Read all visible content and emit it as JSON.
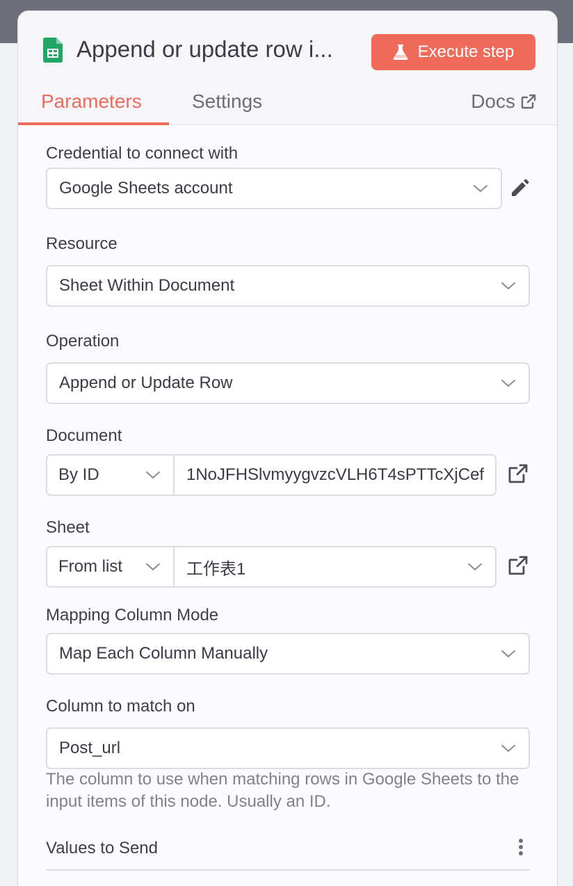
{
  "header": {
    "title": "Append or update row i...",
    "icon": "google-sheets-icon",
    "execute_label": "Execute step",
    "accent_color": "#ef6a5a"
  },
  "tabs": {
    "parameters": "Parameters",
    "settings": "Settings",
    "docs": "Docs"
  },
  "fields": {
    "credential": {
      "label": "Credential to connect with",
      "value": "Google Sheets account"
    },
    "resource": {
      "label": "Resource",
      "value": "Sheet Within Document"
    },
    "operation": {
      "label": "Operation",
      "value": "Append or Update Row"
    },
    "document": {
      "label": "Document",
      "mode": "By ID",
      "value": "1NoJFHSlvmyygvzcVLH6T4sPTTcXjCef"
    },
    "sheet": {
      "label": "Sheet",
      "mode": "From list",
      "value": "工作表1"
    },
    "mapping_mode": {
      "label": "Mapping Column Mode",
      "value": "Map Each Column Manually"
    },
    "match_column": {
      "label": "Column to match on",
      "value": "Post_url",
      "hint": "The column to use when matching rows in Google Sheets to the input items of this node. Usually an ID."
    }
  },
  "values_to_send": {
    "label": "Values to Send"
  }
}
